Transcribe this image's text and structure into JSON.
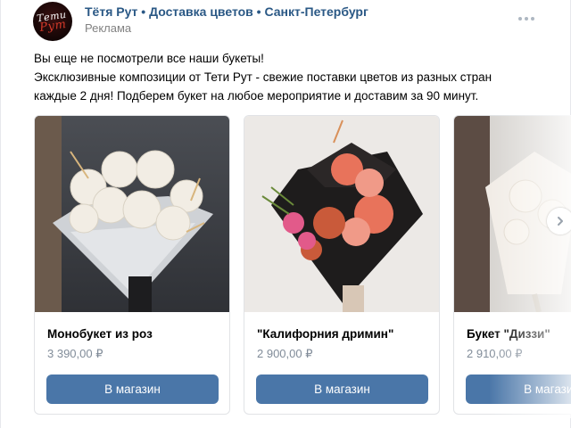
{
  "post": {
    "author": "Тётя Рут • Доставка цветов • Санкт-Петербург",
    "label": "Реклама",
    "avatar_logo_top": "Тети",
    "avatar_logo_bottom": "Рут",
    "text": [
      "Вы еще не посмотрели все наши букеты!",
      "Эксклюзивные композиции от Тети Рут - свежие поставки цветов из разных стран",
      "каждые 2 дня! Подберем букет на любое мероприятие и доставим за 90 минут."
    ],
    "more_icon": "ellipsis-icon"
  },
  "products": [
    {
      "name": "Монобукет из роз",
      "price": "3 390,00 ₽",
      "button": "В магазин"
    },
    {
      "name": "\"Калифорния дримин\"",
      "price": "2 900,00 ₽",
      "button": "В магазин"
    },
    {
      "name": "Букет \"Диззи\"",
      "price": "2 910,00 ₽",
      "button": "В магазин"
    }
  ],
  "carousel": {
    "next_icon": "chevron-right-icon"
  },
  "colors": {
    "link": "#2a5885",
    "button": "#4a76a8",
    "muted": "#818c99"
  }
}
